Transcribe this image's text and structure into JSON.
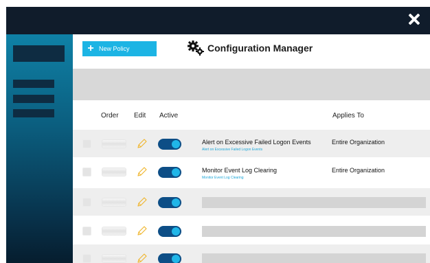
{
  "header": {
    "new_policy_label": "New Policy",
    "title": "Configuration Manager"
  },
  "table": {
    "columns": {
      "order": "Order",
      "edit": "Edit",
      "active": "Active",
      "applies_to": "Applies To"
    },
    "rows": [
      {
        "name": "Alert on Excessive Failed Logon Events",
        "subtitle": "Alert on Excessive Failed Logon Events",
        "applies_to": "Entire Organization",
        "active": true
      },
      {
        "name": "Monitor Event Log Clearing",
        "subtitle": "Monitor Event Log Clearing",
        "applies_to": "Entire Organization",
        "active": true
      },
      {
        "active": true
      },
      {
        "active": true
      },
      {
        "active": true
      }
    ]
  },
  "colors": {
    "accent": "#1cb4e4",
    "toggle_track": "#0d4e86",
    "frame_dark": "#101c2b",
    "pencil": "#f0b429"
  }
}
